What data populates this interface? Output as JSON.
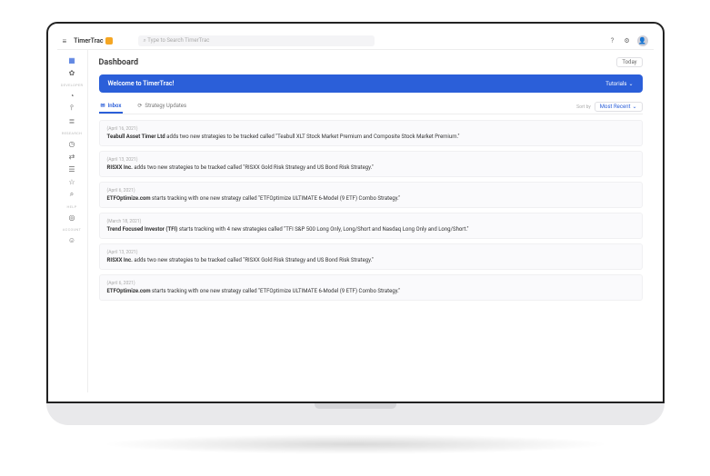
{
  "brand": "TimerTrac",
  "search": {
    "placeholder": "Type to Search TimerTrac"
  },
  "header": {
    "today": "Today",
    "title": "Dashboard"
  },
  "banner": {
    "title": "Welcome to TimerTrac!",
    "tutorials": "Tutorials"
  },
  "tabs": {
    "inbox": "Inbox",
    "strategy": "Strategy Updates"
  },
  "sort": {
    "label": "Sort by",
    "value": "Most Recent"
  },
  "sidebar": {
    "sec1": "DEVELOPER",
    "sec2": "RESEARCH",
    "sec3": "HELP",
    "sec4": "ACCOUNT"
  },
  "feed": [
    {
      "date": "(April 16, 2021)",
      "bold": "Teabull Asset Timer Ltd",
      "rest": " adds two new strategies to be tracked called \"Teabull XLT Stock Market Premium and Composite Stock Market Premium.\""
    },
    {
      "date": "(April 13, 2021)",
      "bold": "RISXX Inc.",
      "rest": " adds two new strategies to be tracked called \"RISXX Gold Risk Strategy and US Bond Risk Strategy.\""
    },
    {
      "date": "(April 6, 2021)",
      "bold": "ETFOptimize.com",
      "rest": " starts tracking with one new strategy called \"ETFOptimize ULTIMATE 6-Model (9 ETF) Combo Strategy.\""
    },
    {
      "date": "(March 18, 2021)",
      "bold": "Trend Focused Investor (TFI)",
      "rest": " starts tracking with 4 new strategies called \"TFI S&P 500 Long Only, Long/Short and Nasdaq Long Only and Long/Short.\""
    },
    {
      "date": "(April 13, 2021)",
      "bold": "RISXX Inc.",
      "rest": " adds two new strategies to be tracked called \"RISXX Gold Risk Strategy and US Bond Risk Strategy.\""
    },
    {
      "date": "(April 6, 2021)",
      "bold": "ETFOptimize.com",
      "rest": " starts tracking with one new strategy called \"ETFOptimize ULTIMATE 6-Model (9 ETF) Combo Strategy.\""
    }
  ]
}
